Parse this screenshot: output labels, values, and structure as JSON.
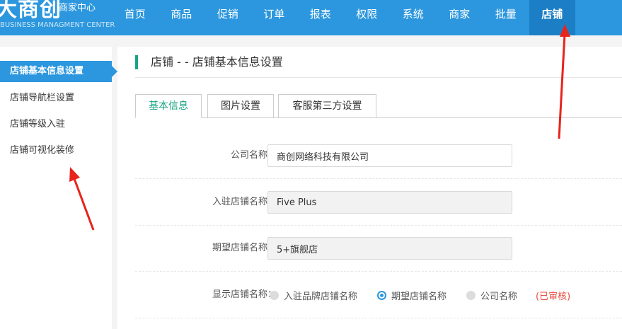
{
  "header": {
    "logo_mark": "大商创",
    "logo_title": "商家中心",
    "logo_subtitle": "BUSINESS MANAGMENT CENTER",
    "nav": [
      {
        "label": "首页",
        "name": "nav-home"
      },
      {
        "label": "商品",
        "name": "nav-goods"
      },
      {
        "label": "促销",
        "name": "nav-promotion"
      },
      {
        "label": "订单",
        "name": "nav-orders"
      },
      {
        "label": "报表",
        "name": "nav-reports"
      },
      {
        "label": "权限",
        "name": "nav-permissions"
      },
      {
        "label": "系统",
        "name": "nav-system"
      },
      {
        "label": "商家",
        "name": "nav-merchant"
      },
      {
        "label": "批量",
        "name": "nav-batch"
      },
      {
        "label": "店铺",
        "name": "nav-store"
      }
    ],
    "active_nav": "店铺"
  },
  "sidebar": {
    "items": [
      {
        "label": "店铺基本信息设置",
        "active": true
      },
      {
        "label": "店铺导航栏设置",
        "active": false
      },
      {
        "label": "店铺等级入驻",
        "active": false
      },
      {
        "label": "店铺可视化装修",
        "active": false
      }
    ]
  },
  "main": {
    "title": "店铺 - - 店铺基本信息设置",
    "tabs": [
      {
        "label": "基本信息",
        "active": true
      },
      {
        "label": "图片设置",
        "active": false
      },
      {
        "label": "客服第三方设置",
        "active": false
      }
    ],
    "form": {
      "company_name": {
        "label": "公司名称：",
        "value": "商创网络科技有限公司"
      },
      "settled_store_name": {
        "label": "入驻店铺名称：",
        "value": "Five Plus"
      },
      "expected_store_name": {
        "label": "期望店铺名称：",
        "value": "5+旗舰店"
      },
      "display_store_name": {
        "label": "显示店铺名称：",
        "options": [
          "入驻品牌店铺名称",
          "期望店铺名称",
          "公司名称"
        ],
        "selected": "期望店铺名称",
        "status": "(已审核)"
      }
    }
  },
  "colors": {
    "topbar": "#2c97de",
    "active_nav": "#1c7fc6",
    "accent_green": "#1aa383",
    "annotation_red": "#e8231b",
    "status_red": "#e84c3d"
  }
}
